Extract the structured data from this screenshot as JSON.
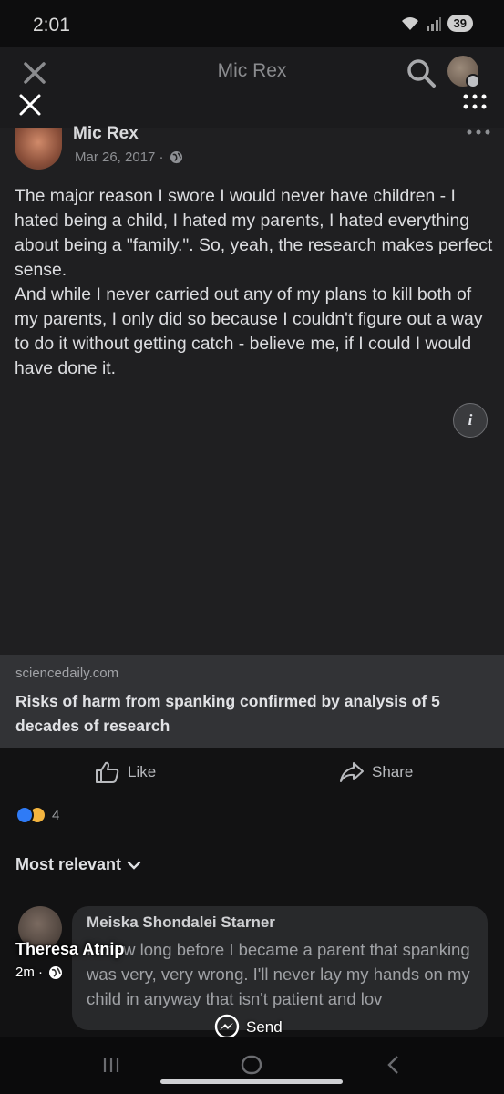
{
  "status_bar": {
    "time": "2:01",
    "battery": "39"
  },
  "header": {
    "title": "Mic Rex"
  },
  "post": {
    "author": "Mic Rex",
    "date": "Mar 26, 2017 ·",
    "paragraphs": [
      "The major reason I swore I would never have children - I hated being a child, I hated my parents, I hated everything about being a \"family.\". So, yeah, the research makes perfect sense.",
      "And while I never carried out any of my plans to kill both of my parents, I only did so because I couldn't figure out a way to do it without getting catch - believe me, if I could I would have done it."
    ],
    "info_label": "i",
    "link": {
      "domain": "sciencedaily.com",
      "title": "Risks of harm from spanking confirmed by analysis of 5 decades of research"
    }
  },
  "actions": {
    "like_label": "Like",
    "share_label": "Share"
  },
  "reactions": {
    "count": "4"
  },
  "comments": {
    "sort_label": "Most relevant",
    "first": {
      "author": "Meiska Shondalei Starner",
      "text": "I knew long before I became a parent that spanking was very, very wrong. I'll never lay my hands on my child in anyway that isn't patient and lov"
    }
  },
  "story": {
    "name": "Theresa Atnip",
    "time": "2m ·",
    "send_label": "Send"
  },
  "colors": {
    "background": "#121213",
    "post_background": "#1f1f21",
    "link_card": "#323336",
    "like_reaction": "#2f7bf6",
    "sad_reaction": "#f3b43f"
  }
}
